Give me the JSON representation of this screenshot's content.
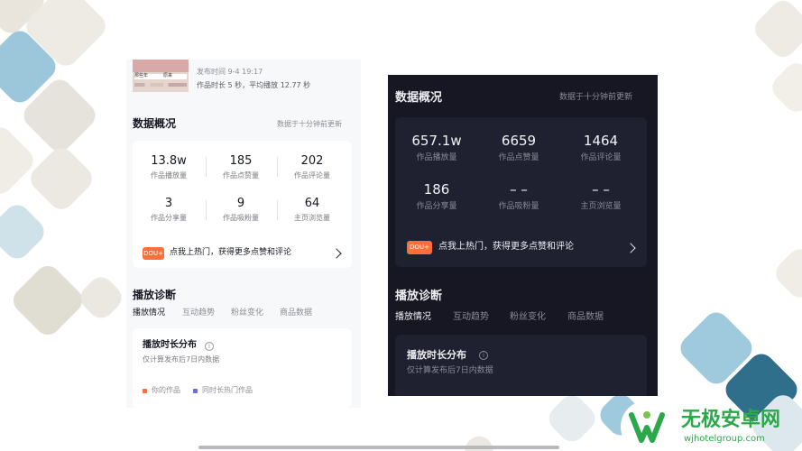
{
  "light_panel": {
    "thumbnail_labels": [
      "那些年",
      "",
      "原来"
    ],
    "publish_time": "发布时间 9-4 19:17",
    "duration_line": "作品时长 5 秒，平均播放 12.77 秒",
    "overview_title": "数据概况",
    "update_note": "数据于十分钟前更新",
    "stats": [
      {
        "value": "13.8w",
        "label": "作品播放量"
      },
      {
        "value": "185",
        "label": "作品点赞量"
      },
      {
        "value": "202",
        "label": "作品评论量"
      },
      {
        "value": "3",
        "label": "作品分享量"
      },
      {
        "value": "9",
        "label": "作品吸粉量"
      },
      {
        "value": "64",
        "label": "主页浏览量"
      }
    ],
    "promo_badge": "DOU+",
    "promo_text": "点我上热门，获得更多点赞和评论",
    "diagnosis_title": "播放诊断",
    "tabs": [
      "播放情况",
      "互动趋势",
      "粉丝变化",
      "商品数据"
    ],
    "duration_card_title": "播放时长分布",
    "duration_card_sub": "仅计算发布后7日内数据",
    "legend": [
      {
        "label": "你的作品",
        "color": "#ff6d3a"
      },
      {
        "label": "同时长热门作品",
        "color": "#6b6fd8"
      }
    ]
  },
  "dark_panel": {
    "overview_title": "数据概况",
    "update_note": "数据于十分钟前更新",
    "stats": [
      {
        "value": "657.1w",
        "label": "作品播放量"
      },
      {
        "value": "6659",
        "label": "作品点赞量"
      },
      {
        "value": "1464",
        "label": "作品评论量"
      },
      {
        "value": "186",
        "label": "作品分享量"
      },
      {
        "value": "– –",
        "label": "作品吸粉量"
      },
      {
        "value": "– –",
        "label": "主页浏览量"
      }
    ],
    "promo_badge": "DOU+",
    "promo_text": "点我上热门，获得更多点赞和评论",
    "diagnosis_title": "播放诊断",
    "tabs": [
      "播放情况",
      "互动趋势",
      "粉丝变化",
      "商品数据"
    ],
    "duration_card_title": "播放时长分布",
    "duration_card_sub": "仅计算发布后7日内数据"
  },
  "watermark": {
    "name": "无极安卓网",
    "url": "wjhotelgroup.com"
  },
  "colors": {
    "accent": "#ff6d3a",
    "dark_bg": "#161722",
    "light_bg": "#f7f8fa",
    "watermark_green": "#2aa84a"
  }
}
